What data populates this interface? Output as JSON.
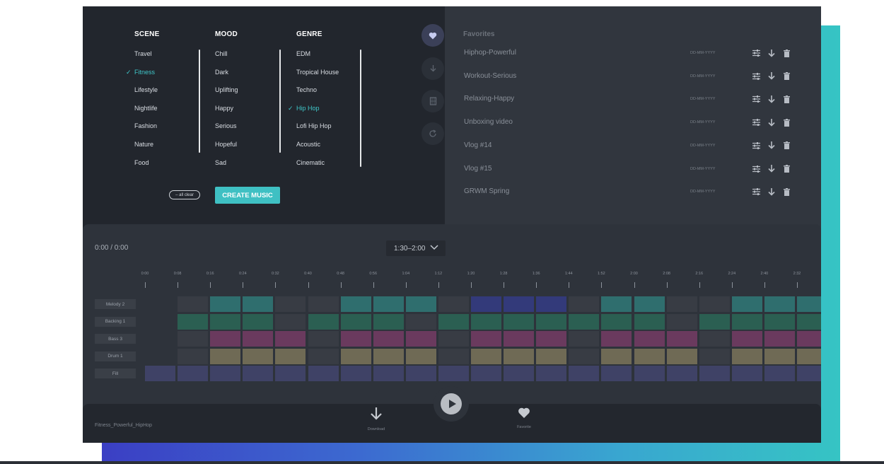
{
  "scene": {
    "title": "SCENE",
    "items": [
      "Travel",
      "Fitness",
      "Lifestyle",
      "Nightlife",
      "Fashion",
      "Nature",
      "Food"
    ],
    "selected": 1
  },
  "mood": {
    "title": "MOOD",
    "items": [
      "Chill",
      "Dark",
      "Uplifting",
      "Happy",
      "Serious",
      "Hopeful",
      "Sad"
    ]
  },
  "genre": {
    "title": "GENRE",
    "items": [
      "EDM",
      "Tropical House",
      "Techno",
      "Hip Hop",
      "Lofi Hip Hop",
      "Acoustic",
      "Cinematic"
    ],
    "selected": 3
  },
  "actions": {
    "clear_label": "– all clear",
    "create_label": "CREATE MUSIC"
  },
  "favorites": {
    "title": "Favorites",
    "items": [
      {
        "name": "Hiphop-Powerful",
        "date": "DD-MM-YYYY"
      },
      {
        "name": "Workout-Serious",
        "date": "DD-MM-YYYY"
      },
      {
        "name": "Relaxing-Happy",
        "date": "DD-MM-YYYY"
      },
      {
        "name": "Unboxing video",
        "date": "DD-MM-YYYY"
      },
      {
        "name": "Vlog #14",
        "date": "DD-MM-YYYY"
      },
      {
        "name": "Vlog #15",
        "date": "DD-MM-YYYY"
      },
      {
        "name": "GRWM Spring",
        "date": "DD-MM-YYYY"
      }
    ]
  },
  "rail_icons": [
    "heart-icon",
    "download-icon",
    "film-icon",
    "refresh-icon"
  ],
  "player": {
    "time": "0:00 / 0:00",
    "range": "1:30–2:00",
    "ticks": [
      "0:00",
      "0:08",
      "0:16",
      "0:24",
      "0:32",
      "0:40",
      "0:48",
      "0:56",
      "1:04",
      "1:12",
      "1:20",
      "1:28",
      "1:36",
      "1:44",
      "1:52",
      "2:00",
      "2:08",
      "2:16",
      "2:24",
      "2:40",
      "2:32"
    ],
    "tracks": [
      {
        "name": "Melody 2",
        "color": "#2f6e6e",
        "fill": [
          0,
          0,
          1,
          1,
          0,
          0,
          1,
          1,
          1,
          0,
          2,
          2,
          2,
          0,
          1,
          1,
          0,
          0,
          1,
          1,
          1
        ]
      },
      {
        "name": "Backing 1",
        "color": "#2b5f52",
        "fill": [
          0,
          1,
          1,
          1,
          0,
          1,
          1,
          1,
          0,
          1,
          1,
          1,
          1,
          1,
          1,
          1,
          0,
          1,
          1,
          1,
          1
        ]
      },
      {
        "name": "Bass 3",
        "color": "#6a3a5e",
        "fill": [
          0,
          0,
          1,
          1,
          1,
          0,
          1,
          1,
          1,
          0,
          1,
          1,
          1,
          0,
          1,
          1,
          1,
          0,
          1,
          1,
          1
        ]
      },
      {
        "name": "Drum 1",
        "color": "#6f6a55",
        "fill": [
          0,
          0,
          1,
          1,
          1,
          0,
          1,
          1,
          1,
          0,
          1,
          1,
          1,
          0,
          1,
          1,
          1,
          0,
          1,
          1,
          1
        ]
      },
      {
        "name": "Fill",
        "color": "#3f4266",
        "fill": [
          1,
          1,
          1,
          1,
          1,
          1,
          1,
          1,
          1,
          1,
          1,
          1,
          1,
          1,
          1,
          1,
          1,
          1,
          1,
          1,
          1
        ]
      }
    ],
    "empty_color": "#383c44",
    "alt_color": "#333a7a"
  },
  "bottom": {
    "file_name": "Fitness_Powerful_HipHop",
    "download_label": "Download",
    "favorite_label": "Favorite"
  },
  "colors": {
    "accent": "#3fc0c3",
    "background": "#2a2f37"
  }
}
